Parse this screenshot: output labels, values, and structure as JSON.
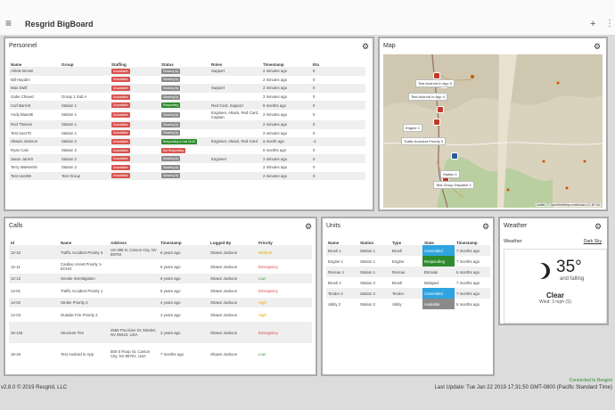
{
  "app": {
    "title": "Resgrid BigBoard"
  },
  "personnel": {
    "title": "Personnel",
    "headers": [
      "Name",
      "Group",
      "Staffing",
      "Status",
      "Roles",
      "Timestamp",
      "Eta"
    ],
    "rows": [
      {
        "name": "Ahlele Brown",
        "group": "",
        "staffing": "Unavailable",
        "staffing_color": "red",
        "status": "Standing By",
        "status_color": "gray",
        "roles": "Support",
        "timestamp": "2 minutes ago",
        "eta": "0"
      },
      {
        "name": "Bill Hayden",
        "group": "",
        "staffing": "Unavailable",
        "staffing_color": "red",
        "status": "Standing By",
        "status_color": "gray",
        "roles": "",
        "timestamp": "2 minutes ago",
        "eta": "0"
      },
      {
        "name": "Max Swift",
        "group": "",
        "staffing": "Unavailable",
        "staffing_color": "red",
        "status": "Standing By",
        "status_color": "gray",
        "roles": "Support",
        "timestamp": "2 minutes ago",
        "eta": "0"
      },
      {
        "name": "Gabe Chavez",
        "group": "Group 1 Sub A",
        "staffing": "Unavailable",
        "staffing_color": "red",
        "status": "Standing By",
        "status_color": "gray",
        "roles": "",
        "timestamp": "2 minutes ago",
        "eta": "0"
      },
      {
        "name": "Carl Barrett",
        "group": "Station 1",
        "staffing": "Unavailable",
        "staffing_color": "red",
        "status": "Responding",
        "status_color": "green",
        "roles": "Red Card, Support",
        "timestamp": "9 months ago",
        "eta": "0"
      },
      {
        "name": "Andy Biasotti",
        "group": "Station 1",
        "staffing": "Unavailable",
        "staffing_color": "red",
        "status": "Standing By",
        "status_color": "gray",
        "roles": "Engineer, Attack, Red Card, Captain",
        "timestamp": "2 minutes ago",
        "eta": "0"
      },
      {
        "name": "Rod Theisen",
        "group": "Station 1",
        "staffing": "Unavailable",
        "staffing_color": "red",
        "status": "Standing By",
        "status_color": "gray",
        "roles": "",
        "timestamp": "2 minutes ago",
        "eta": "0"
      },
      {
        "name": "Test User70",
        "group": "Station 1",
        "staffing": "Unavailable",
        "staffing_color": "red",
        "status": "Standing By",
        "status_color": "gray",
        "roles": "",
        "timestamp": "2 minutes ago",
        "eta": "0"
      },
      {
        "name": "Shawn Jackson",
        "group": "Station 2",
        "staffing": "Unavailable",
        "staffing_color": "red",
        "status": "Responding to Call 18-34",
        "status_color": "green",
        "roles": "Engineer, Attack, Red Card",
        "timestamp": "a month ago",
        "eta": "-1"
      },
      {
        "name": "Ryan Cain",
        "group": "Station 2",
        "staffing": "Unavailable",
        "staffing_color": "red",
        "status": "Not Responding",
        "status_color": "red",
        "roles": "",
        "timestamp": "6 months ago",
        "eta": "0"
      },
      {
        "name": "Jason Jarrett",
        "group": "Station 2",
        "staffing": "Unavailable",
        "staffing_color": "red",
        "status": "Standing By",
        "status_color": "gray",
        "roles": "Engineer",
        "timestamp": "2 minutes ago",
        "eta": "0"
      },
      {
        "name": "Terry Warkentin",
        "group": "Station 2",
        "staffing": "Unavailable",
        "staffing_color": "red",
        "status": "Standing By",
        "status_color": "gray",
        "roles": "",
        "timestamp": "2 minutes ago",
        "eta": "0"
      },
      {
        "name": "Test User69",
        "group": "Test Group",
        "staffing": "Unavailable",
        "staffing_color": "red",
        "status": "Standing By",
        "status_color": "gray",
        "roles": "",
        "timestamp": "2 minutes ago",
        "eta": "0"
      }
    ]
  },
  "map": {
    "title": "Map",
    "labels": [
      "Test Android In App 5",
      "Test Android In App 4",
      "Engine 1",
      "Traffic Accident Priority 3",
      "Station 1",
      "Test Group Dispatch 2"
    ],
    "attribution": "Leaflet | © OpenStreetMap contributors CC-BY-SA"
  },
  "calls": {
    "title": "Calls",
    "headers": [
      "Id",
      "Name",
      "Address",
      "Timestamp",
      "Logged By",
      "Priority"
    ],
    "rows": [
      {
        "id": "12-10",
        "name": "Traffic Accident Priority 3",
        "address": "US-395 N, Carson City, NV 89703",
        "timestamp": "6 years ago",
        "logged_by": "Shawn Jackson",
        "priority": "Medium",
        "priority_class": "medium"
      },
      {
        "id": "12-11",
        "name": "Cardiac Arrest Priority 1-ECHO",
        "address": "",
        "timestamp": "6 years ago",
        "logged_by": "Shawn Jackson",
        "priority": "Emergency",
        "priority_class": "emergency"
      },
      {
        "id": "12-13",
        "name": "Smoke Investigation",
        "address": "",
        "timestamp": "6 years ago",
        "logged_by": "Shawn Jackson",
        "priority": "Low",
        "priority_class": "low"
      },
      {
        "id": "14-01",
        "name": "Traffic Accident Priority 1",
        "address": "",
        "timestamp": "5 years ago",
        "logged_by": "Shawn Jackson",
        "priority": "Emergency",
        "priority_class": "emergency"
      },
      {
        "id": "14-02",
        "name": "Stroke Priority 2",
        "address": "",
        "timestamp": "4 years ago",
        "logged_by": "Shawn Jackson",
        "priority": "High",
        "priority_class": "high"
      },
      {
        "id": "14-03",
        "name": "Outside Fire Priority 2",
        "address": "",
        "timestamp": "4 years ago",
        "logged_by": "Shawn Jackson",
        "priority": "High",
        "priority_class": "high"
      },
      {
        "id": "15-126",
        "name": "Structure Fire",
        "address": "2559 Precision Dr, Minden, NV 89423, USA",
        "timestamp": "3 years ago",
        "logged_by": "Shawn Jackson",
        "priority": "Emergency",
        "priority_class": "emergency"
      },
      {
        "id": "18-25",
        "name": "Test Android In App",
        "address": "500 S Roop St, Carson City, NV 89701, USA",
        "timestamp": "7 months ago",
        "logged_by": "Shawn Jackson",
        "priority": "Low",
        "priority_class": "low"
      }
    ]
  },
  "units": {
    "title": "Units",
    "headers": [
      "Name",
      "Station",
      "Type",
      "State",
      "Timestamp"
    ],
    "rows": [
      {
        "name": "Brush 1",
        "station": "Station 1",
        "type": "Brush",
        "state": "Committed",
        "state_color": "#2fa4e0",
        "timestamp": "7 months ago"
      },
      {
        "name": "Engine 1",
        "station": "Station 1",
        "type": "Engine",
        "state": "Responding",
        "state_color": "#2e8b2e",
        "timestamp": "7 months ago"
      },
      {
        "name": "Rescue 1",
        "station": "Station 1",
        "type": "Rescue",
        "state": "Enroute",
        "state_color": "",
        "timestamp": "6 months ago"
      },
      {
        "name": "Brush 2",
        "station": "Station 2",
        "type": "Brush",
        "state": "Delayed",
        "state_color": "",
        "timestamp": "7 months ago"
      },
      {
        "name": "Tender 2",
        "station": "Station 2",
        "type": "Tender",
        "state": "Committed",
        "state_color": "#2fa4e0",
        "timestamp": "7 months ago"
      },
      {
        "name": "Utility 2",
        "station": "Station 2",
        "type": "Utility",
        "state": "Available",
        "state_color": "#8a8a8a",
        "timestamp": "5 months ago"
      }
    ]
  },
  "weather": {
    "title": "Weather",
    "subtitle": "Weather",
    "link": "Dark Sky",
    "icon": "moon-icon",
    "temp": "35°",
    "trend": "and falling",
    "condition": "Clear",
    "wind": "Wind: 3 mph (S)"
  },
  "footer": {
    "connection": "Connected to Resgrid",
    "version": "v2.8.0 © 2019 Resgrid, LLC",
    "last_update": "Last Update: Tue Jan 22 2019 17:31:50 GMT-0800 (Pacific Standard Time)"
  }
}
